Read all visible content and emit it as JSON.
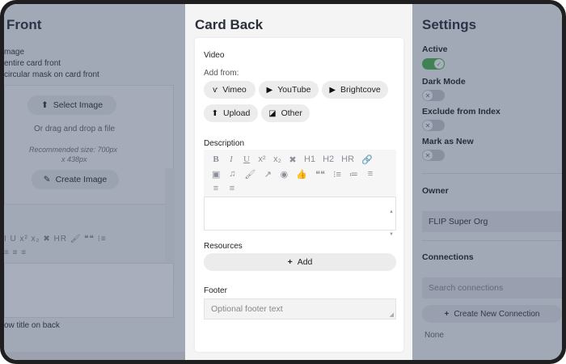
{
  "card_front": {
    "title": "Front",
    "image_heading": "mage",
    "option1": "entire card front",
    "option2": "circular mask on card front",
    "select_image": "Select Image",
    "drag_text": "Or drag and drop a file",
    "recommended_1": "Recommended size: 700px",
    "recommended_2": "x 438px",
    "create_image": "Create Image",
    "toolbar_row1": "I  U  x²  x₂  ✖  HR  🖌  ❝❝  ⁝≡",
    "toolbar_row2": "≡  ≡  ≡",
    "show_title": "ow title on back"
  },
  "card_back": {
    "title": "Card Back",
    "video_label": "Video",
    "add_from": "Add from:",
    "buttons": [
      "Vimeo",
      "YouTube",
      "Brightcove",
      "Upload",
      "Other"
    ],
    "description_label": "Description",
    "toolbar_row1": [
      "B",
      "I",
      "U",
      "x²",
      "x₂",
      "✖",
      "H1",
      "H2",
      "HR",
      "🔗"
    ],
    "toolbar_row2": [
      "▣",
      "♫",
      "🖌",
      "↗",
      "◉",
      "👍",
      "❝❝",
      "⁝≡",
      "≔",
      "≡"
    ],
    "toolbar_row3": [
      "≡",
      "≡"
    ],
    "resources_label": "Resources",
    "add_label": "Add",
    "footer_label": "Footer",
    "footer_placeholder": "Optional footer text"
  },
  "settings": {
    "title": "Settings",
    "active_label": "Active",
    "dark_mode_label": "Dark Mode",
    "exclude_label": "Exclude from Index",
    "mark_new_label": "Mark as New",
    "owner_label": "Owner",
    "owner_value": "FLIP Super Org",
    "connections_label": "Connections",
    "search_placeholder": "Search connections",
    "create_connection": "Create New Connection",
    "none_text": "None"
  }
}
